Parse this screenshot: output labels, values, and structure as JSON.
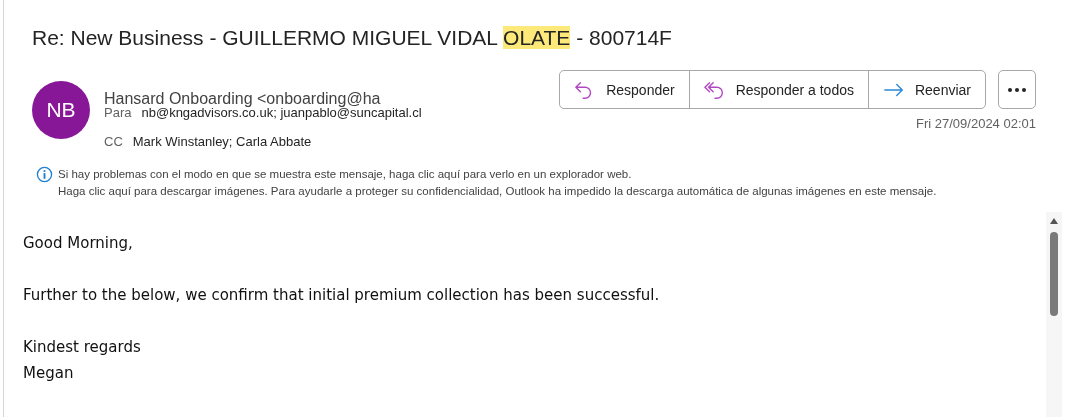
{
  "subject": [
    {
      "text": "Re: New Business - GUILLERMO MIGUEL VIDAL ",
      "highlighted": false
    },
    {
      "text": "OLATE",
      "highlighted": true
    },
    {
      "text": " - 800714F",
      "highlighted": false
    }
  ],
  "sender": {
    "initials": "NB",
    "name": "Hansard Onboarding <onboarding@ha",
    "to_label": "Para",
    "to": "nb@kngadvisors.co.uk; juanpablo@suncapital.cl",
    "cc_label": "CC",
    "cc": "Mark Winstanley; Carla Abbate"
  },
  "actions": [
    {
      "kind": "reply",
      "label": "Responder"
    },
    {
      "kind": "reply_all",
      "label": "Responder a todos"
    },
    {
      "kind": "forward",
      "label": "Reenviar"
    }
  ],
  "date": "Fri 27/09/2024 02:01",
  "info": [
    "Si hay problemas con el modo en que se muestra este mensaje, haga clic aquí para verlo en un explorador web.",
    "Haga clic aquí para descargar imágenes. Para ayudarle a proteger su confidencialidad, Outlook ha impedido la descarga automática de algunas imágenes en este mensaje."
  ],
  "body": [
    [
      "Good Morning,"
    ],
    [
      "Further to the below, we confirm that initial premium collection has been successful."
    ],
    [
      "Kindest regards",
      "Megan"
    ]
  ]
}
